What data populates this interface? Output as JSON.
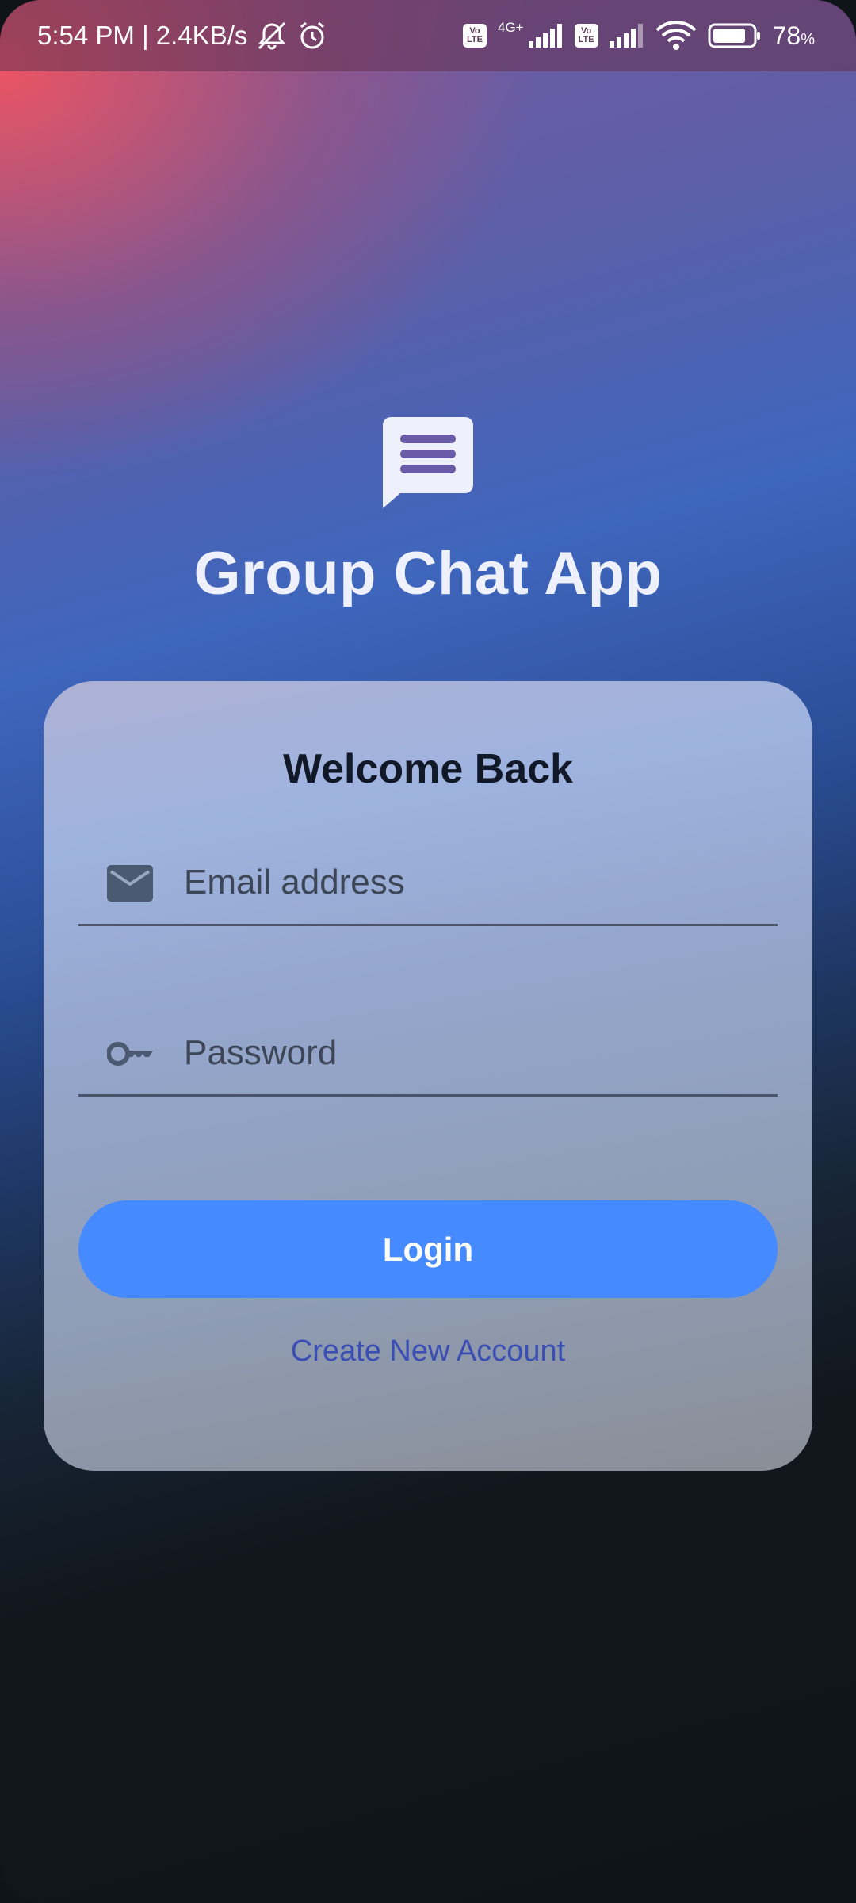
{
  "status_bar": {
    "time_speed": "5:54 PM | 2.4KB/s",
    "net_type": "4G+",
    "volte_line1": "Vo",
    "volte_line2": "LTE",
    "battery_value": "78",
    "battery_unit": "%"
  },
  "header": {
    "logo_icon": "chat-bubble-icon",
    "title": "Group Chat App"
  },
  "login_card": {
    "title": "Welcome Back",
    "email": {
      "placeholder": "Email address",
      "value": "",
      "icon": "mail-icon"
    },
    "password": {
      "placeholder": "Password",
      "value": "",
      "icon": "key-icon"
    },
    "login_button": "Login",
    "create_account_link": "Create New Account"
  },
  "colors": {
    "accent_button": "#468aff",
    "link": "#3a4eb4",
    "title_text": "#eef0fb"
  }
}
